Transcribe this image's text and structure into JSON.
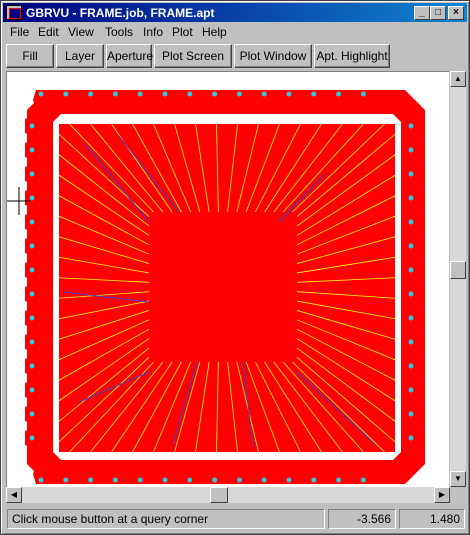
{
  "window": {
    "title": "GBRVU - FRAME.job, FRAME.apt",
    "minimize_glyph": "_",
    "maximize_glyph": "□",
    "close_glyph": "×"
  },
  "menu": [
    "File",
    "Edit",
    "View",
    "Tools",
    "Info",
    "Plot",
    "Help"
  ],
  "toolbar": [
    "Fill",
    "Layer",
    "Aperture",
    "Plot Screen",
    "Plot Window",
    "Apt. Highlight"
  ],
  "status": {
    "message": "Click mouse button at a query corner",
    "x_coord": "-3.566",
    "y_coord": "1.480"
  },
  "colors": {
    "copper": "#ff0000",
    "trace": "#ffff00",
    "via_trace": "#4040d0",
    "pad_hole": "#30c8e0",
    "background": "#ffffff"
  },
  "icons": {
    "crosshair": "crosshair-cursor-icon",
    "scroll_up": "arrow-up-icon",
    "scroll_down": "arrow-down-icon",
    "scroll_left": "arrow-left-icon",
    "scroll_right": "arrow-right-icon"
  }
}
